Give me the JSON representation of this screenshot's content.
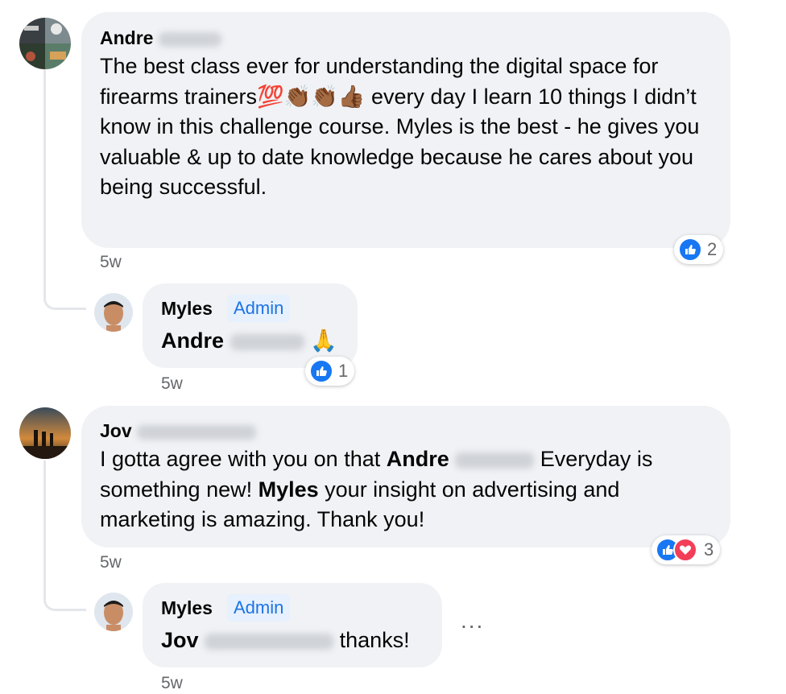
{
  "comments": [
    {
      "author": "Andre",
      "text": "The best class ever for understanding the digital space for firearms trainers💯👏🏾👏🏾👍🏾  every day I learn 10 things I didn’t know in this challenge course. Myles is the best - he gives you valuable & up to date knowledge because he cares about you being successful.",
      "time": "5w",
      "reaction_count": "2",
      "reply": {
        "author": "Myles",
        "badge": "Admin",
        "mention": "Andre",
        "emoji": "🙏",
        "time": "5w",
        "reaction_count": "1"
      }
    },
    {
      "author": "Jov",
      "text_before": "I gotta agree with you on that ",
      "mention": "Andre",
      "text_mid": "Everyday is something new! ",
      "mention2": "Myles",
      "text_after": " your insight on advertising and marketing is amazing. Thank you!",
      "time": "5w",
      "reaction_count": "3",
      "reply": {
        "author": "Myles",
        "badge": "Admin",
        "mention": "Jov",
        "text": "thanks!",
        "time": "5w",
        "more": "..."
      }
    }
  ],
  "colors": {
    "accent": "#1877f2",
    "heart": "#f33e58",
    "bubble": "#f0f2f5",
    "meta": "#65676b"
  },
  "icons": [
    "like-icon",
    "heart-icon",
    "more-icon"
  ]
}
